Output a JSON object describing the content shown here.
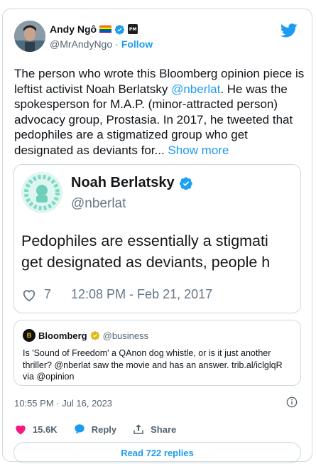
{
  "author": {
    "name": "Andy Ngô",
    "handle": "@MrAndyNgo",
    "follow_label": "Follow",
    "badge_text": "PM"
  },
  "tweet": {
    "text_before": "The person who wrote this Bloomberg opinion piece is leftist activist Noah Berlatsky ",
    "mention": "@nberlat",
    "text_after": ". He was the spokesperson for M.A.P. (minor-attracted person) advocacy group, Prostasia. In 2017, he tweeted that pedophiles are a stigmatized group who get designated as deviants for... ",
    "show_more": "Show more"
  },
  "embedded_image": {
    "name": "Noah Berlatsky",
    "handle": "@nberlat",
    "line1": "Pedophiles are essentially a stigmati",
    "line2": "get designated as deviants, people h",
    "likes": "7",
    "timestamp": "12:08 PM - Feb 21, 2017"
  },
  "quote": {
    "logo_letter": "B",
    "name": "Bloomberg",
    "handle": "@business",
    "text": "Is 'Sound of Freedom' a QAnon dog whistle, or is it just another thriller? @nberlat saw the movie and has an answer. trib.al/iclglqR via @opinion"
  },
  "timestamp": "10:55 PM · Jul 16, 2023",
  "actions": {
    "likes": "15.6K",
    "reply": "Reply",
    "share": "Share"
  },
  "read_replies": "Read 722 replies",
  "colors": {
    "accent": "#1d9bf0",
    "like": "#f91880",
    "border": "#cfd9de",
    "muted": "#536471",
    "gold": "#e2b719"
  }
}
